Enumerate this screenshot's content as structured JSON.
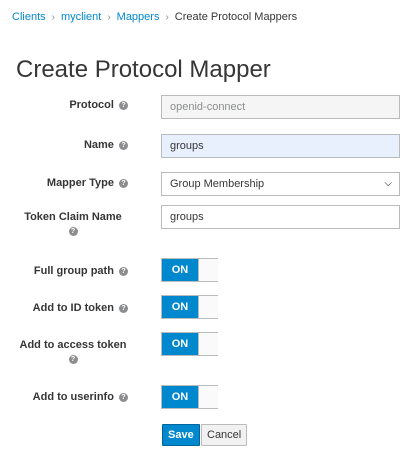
{
  "breadcrumb": {
    "items": [
      "Clients",
      "myclient",
      "Mappers"
    ],
    "current": "Create Protocol Mappers"
  },
  "page": {
    "title": "Create Protocol Mapper"
  },
  "help_icon_glyph": "?",
  "form": {
    "protocol": {
      "label": "Protocol",
      "value": "openid-connect"
    },
    "name": {
      "label": "Name",
      "value": "groups"
    },
    "mapper_type": {
      "label": "Mapper Type",
      "value": "Group Membership"
    },
    "token_claim_name": {
      "label": "Token Claim Name",
      "value": "groups"
    },
    "full_group_path": {
      "label": "Full group path",
      "state": "ON"
    },
    "add_to_id_token": {
      "label": "Add to ID token",
      "state": "ON"
    },
    "add_to_access_token": {
      "label": "Add to access token",
      "state": "ON"
    },
    "add_to_userinfo": {
      "label": "Add to userinfo",
      "state": "ON"
    }
  },
  "actions": {
    "save_label": "Save",
    "cancel_label": "Cancel"
  },
  "colors": {
    "accent": "#0088ce",
    "link": "#0088ce",
    "text": "#363636",
    "help_icon": "#8b8d8f"
  }
}
